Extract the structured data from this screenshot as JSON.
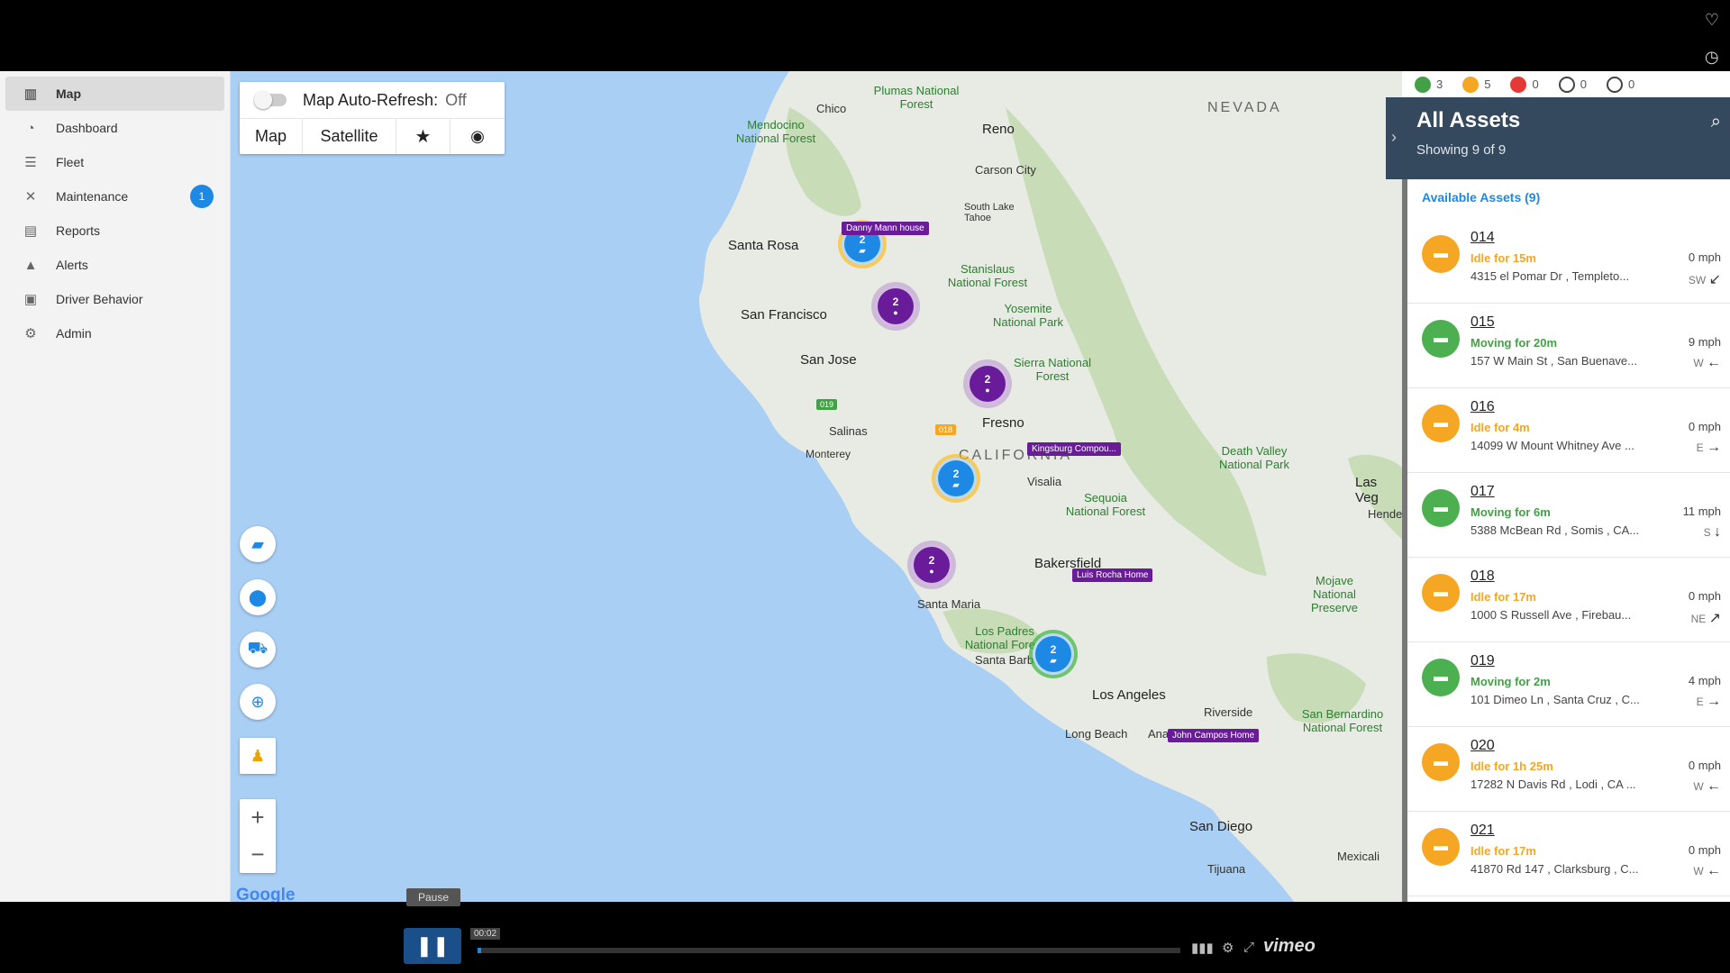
{
  "nav": {
    "items": [
      {
        "label": "Map",
        "icon": "map-icon"
      },
      {
        "label": "Dashboard",
        "icon": "dashboard-icon"
      },
      {
        "label": "Fleet",
        "icon": "list-icon"
      },
      {
        "label": "Maintenance",
        "icon": "wrench-icon",
        "badge": "1"
      },
      {
        "label": "Reports",
        "icon": "report-icon"
      },
      {
        "label": "Alerts",
        "icon": "warning-icon"
      },
      {
        "label": "Driver Behavior",
        "icon": "clipboard-icon"
      },
      {
        "label": "Admin",
        "icon": "gear-icon"
      }
    ]
  },
  "map_controls": {
    "refresh_label": "Map Auto-Refresh:",
    "refresh_state": "Off",
    "type_map": "Map",
    "type_satellite": "Satellite"
  },
  "map": {
    "labels": {
      "nevada": "NEVADA",
      "california": "CALIFORNIA",
      "chico": "Chico",
      "reno": "Reno",
      "carson": "Carson City",
      "south_lake": "South Lake Tahoe",
      "santa_rosa": "Santa Rosa",
      "san_francisco": "San Francisco",
      "san_jose": "San Jose",
      "salinas": "Salinas",
      "monterey": "Monterey",
      "fresno": "Fresno",
      "visalia": "Visalia",
      "bakersfield": "Bakersfield",
      "santa_maria": "Santa Maria",
      "santa_barbara": "Santa Barbara",
      "los_angeles": "Los Angeles",
      "anaheim": "Anaheim",
      "long_beach": "Long Beach",
      "riverside": "Riverside",
      "san_diego": "San Diego",
      "tijuana": "Tijuana",
      "mexicali": "Mexicali",
      "las_vegas": "Las Veg",
      "hende": "Hende",
      "plumas": "Plumas National Forest",
      "mendocino": "Mendocino National Forest",
      "stanislaus": "Stanislaus National Forest",
      "yosemite": "Yosemite National Park",
      "sierra": "Sierra National Forest",
      "death_valley": "Death Valley National Park",
      "sequoia": "Sequoia National Forest",
      "mojave": "Mojave National Preserve",
      "los_padres": "Los Padres National Forest",
      "san_bernardino": "San Bernardino National Forest"
    },
    "clusters": [
      "2",
      "2",
      "2",
      "2",
      "2",
      "2"
    ],
    "poi": {
      "danny": "Danny Mann house",
      "kingsburg": "Kingsburg Compou...",
      "luis": "Luis Rocha Home",
      "john": "John Campos Home",
      "tag019": "019",
      "tag018": "018"
    },
    "google": "Google"
  },
  "status_bar": {
    "moving": "3",
    "idle": "5",
    "stopped": "0",
    "off": "0",
    "other": "0"
  },
  "panel": {
    "title": "All Assets",
    "subtitle": "Showing 9 of 9",
    "available": "Available Assets (9)",
    "assets": [
      {
        "id": "014",
        "status": "Idle for 15m",
        "addr": "4315 el Pomar Dr , Templeto...",
        "speed": "0 mph",
        "dir": "SW",
        "color": "#f5a623",
        "status_color": "#f5a623"
      },
      {
        "id": "015",
        "status": "Moving for 20m",
        "addr": "157 W Main St , San Buenave...",
        "speed": "9 mph",
        "dir": "W",
        "color": "#4caf50",
        "status_color": "#43a047"
      },
      {
        "id": "016",
        "status": "Idle for 4m",
        "addr": "14099 W Mount Whitney Ave ...",
        "speed": "0 mph",
        "dir": "E",
        "color": "#f5a623",
        "status_color": "#f5a623"
      },
      {
        "id": "017",
        "status": "Moving for 6m",
        "addr": "5388 McBean Rd , Somis , CA...",
        "speed": "11 mph",
        "dir": "S",
        "color": "#4caf50",
        "status_color": "#43a047"
      },
      {
        "id": "018",
        "status": "Idle for 17m",
        "addr": "1000 S Russell Ave , Firebau...",
        "speed": "0 mph",
        "dir": "NE",
        "color": "#f5a623",
        "status_color": "#f5a623"
      },
      {
        "id": "019",
        "status": "Moving for 2m",
        "addr": "101 Dimeo Ln , Santa Cruz , C...",
        "speed": "4 mph",
        "dir": "E",
        "color": "#4caf50",
        "status_color": "#43a047"
      },
      {
        "id": "020",
        "status": "Idle for 1h 25m",
        "addr": "17282 N Davis Rd , Lodi , CA ...",
        "speed": "0 mph",
        "dir": "W",
        "color": "#f5a623",
        "status_color": "#f5a623"
      },
      {
        "id": "021",
        "status": "Idle for 17m",
        "addr": "41870 Rd 147 , Clarksburg , C...",
        "speed": "0 mph",
        "dir": "W",
        "color": "#f5a623",
        "status_color": "#f5a623"
      }
    ]
  },
  "player": {
    "tooltip": "Pause",
    "time": "00:02",
    "brand": "vimeo",
    "progress": 0.005
  }
}
